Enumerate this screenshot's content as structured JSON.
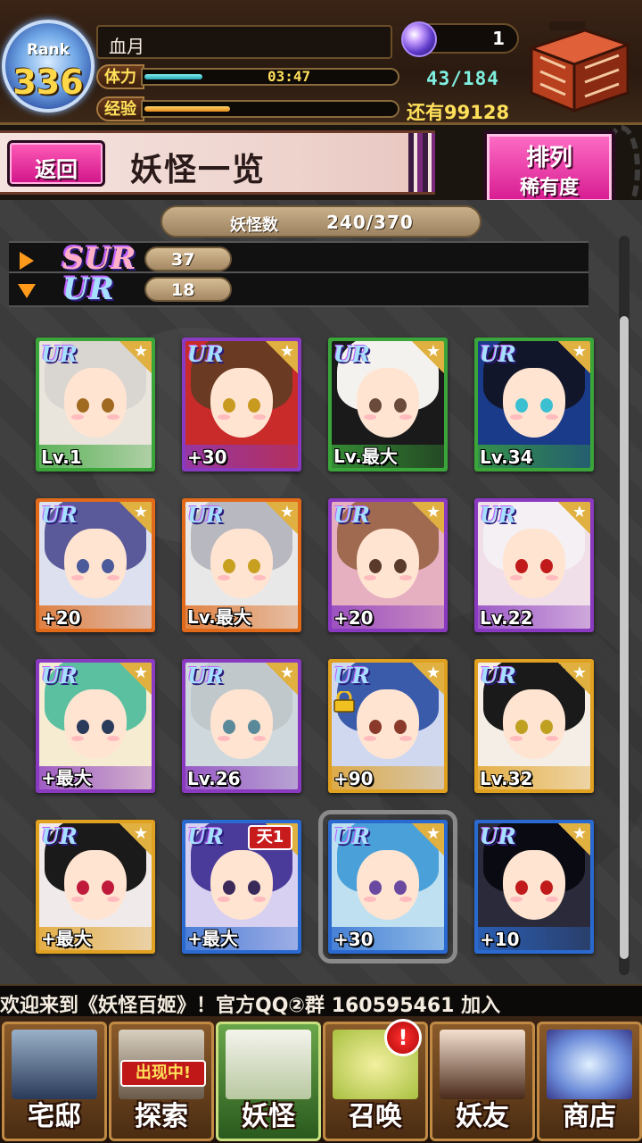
{
  "header": {
    "rank_label": "Rank",
    "rank_value": "336",
    "player_name": "血月",
    "stamina_label": "体力",
    "stamina_timer": "03:47",
    "stamina_fraction": 0.23,
    "stamina_count": "43/184",
    "exp_label": "经验",
    "exp_fraction": 0.34,
    "exp_remaining": "还有99128",
    "orb_count": "1",
    "orb_icon": "magic-orb-icon",
    "chest_icon": "gift-chest-icon"
  },
  "titlebar": {
    "back_label": "返回",
    "title": "妖怪一览",
    "sort_label": "排列",
    "sort_value": "稀有度"
  },
  "collection": {
    "count_label": "妖怪数",
    "count_value": "240/370"
  },
  "rarity_groups": [
    {
      "badge": "SUR",
      "count": "37",
      "expanded": false
    },
    {
      "badge": "UR",
      "count": "18",
      "expanded": true
    }
  ],
  "cards": [
    {
      "rarity": "UR",
      "level": "Lv.1",
      "frame": "#3aa63a",
      "bg": "#e9e4dc",
      "hair": "#d9d5d0",
      "eye": "#a06a20"
    },
    {
      "rarity": "UR",
      "level": "+30",
      "frame": "#8a3ac0",
      "bg": "#c92a2a",
      "hair": "#6b3a22",
      "eye": "#c89a20"
    },
    {
      "rarity": "UR",
      "level": "Lv.最大",
      "frame": "#3aa63a",
      "bg": "#1a1a1a",
      "hair": "#f4f2ee",
      "eye": "#6a4a3a"
    },
    {
      "rarity": "UR",
      "level": "Lv.34",
      "frame": "#3aa63a",
      "bg": "#1a3a8a",
      "hair": "#12162a",
      "eye": "#3ac0d0"
    },
    {
      "rarity": "UR",
      "level": "+20",
      "frame": "#e06a1a",
      "bg": "#dde0ee",
      "hair": "#5a5a9a",
      "eye": "#4a5a9a"
    },
    {
      "rarity": "UR",
      "level": "Lv.最大",
      "frame": "#e06a1a",
      "bg": "#e8e8e8",
      "hair": "#b8b8c0",
      "eye": "#c8a020"
    },
    {
      "rarity": "UR",
      "level": "+20",
      "frame": "#8a3ac0",
      "bg": "#e6b0c0",
      "hair": "#a06a50",
      "eye": "#5a3a2a"
    },
    {
      "rarity": "UR",
      "level": "Lv.22",
      "frame": "#8a3ac0",
      "bg": "#f0dfe8",
      "hair": "#f4f0f4",
      "eye": "#c01a1a"
    },
    {
      "rarity": "UR",
      "level": "+最大",
      "frame": "#8a3ac0",
      "bg": "#f6ecd2",
      "hair": "#5ac0a0",
      "eye": "#2a3a5a"
    },
    {
      "rarity": "UR",
      "level": "Lv.26",
      "frame": "#8a3ac0",
      "bg": "#cfd8dc",
      "hair": "#c0c8cc",
      "eye": "#5a8a9a"
    },
    {
      "rarity": "UR",
      "level": "+90",
      "frame": "#e0a020",
      "bg": "#d0d8f0",
      "hair": "#3a5aaa",
      "eye": "#8a3a2a"
    },
    {
      "rarity": "UR",
      "level": "Lv.32",
      "frame": "#e0a020",
      "bg": "#f4eee6",
      "hair": "#1a1a1a",
      "eye": "#c0a020"
    },
    {
      "rarity": "UR",
      "level": "+最大",
      "frame": "#e0a020",
      "bg": "#f0eaea",
      "hair": "#1a1a1a",
      "eye": "#c01a3a"
    },
    {
      "rarity": "UR",
      "level": "+最大",
      "frame": "#2a6ad0",
      "bg": "#d8d0f0",
      "hair": "#4a3a9a",
      "eye": "#3a2a5a",
      "skill": "天1"
    },
    {
      "rarity": "UR",
      "level": "+30",
      "frame": "#2a6ad0",
      "bg": "#bfe0f0",
      "hair": "#4aa0d8",
      "eye": "#6a4aa0",
      "selected": true
    },
    {
      "rarity": "UR",
      "level": "+10",
      "frame": "#2a6ad0",
      "bg": "#2a2a3a",
      "hair": "#0a0a12",
      "eye": "#c01a1a"
    }
  ],
  "ticker": "欢迎来到《妖怪百姬》！官方QQ②群 160595461    加入",
  "nav": [
    {
      "label": "宅邸",
      "icon": "mansion-icon",
      "active": false
    },
    {
      "label": "探索",
      "icon": "explore-icon",
      "sublabel": "出现中!",
      "active": false
    },
    {
      "label": "妖怪",
      "icon": "yokai-scroll-icon",
      "active": true
    },
    {
      "label": "召唤",
      "icon": "summon-icon",
      "alert": "!",
      "active": false
    },
    {
      "label": "妖友",
      "icon": "friends-icon",
      "active": false
    },
    {
      "label": "商店",
      "icon": "shop-orb-icon",
      "active": false
    }
  ],
  "colors": {
    "accent_pink": "#d61a90",
    "gold": "#ffd84a",
    "panel_bg": "#3b3b3b"
  }
}
